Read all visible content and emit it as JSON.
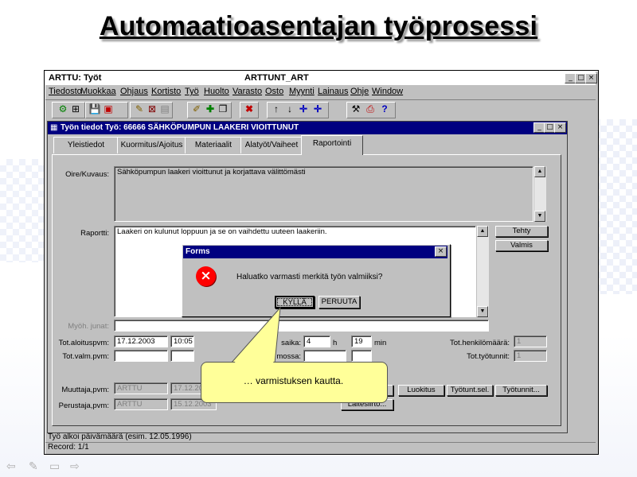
{
  "slide": {
    "title": "Automaatioasentajan työprosessi",
    "callout": "… varmistuksen kautta."
  },
  "app": {
    "title": "ARTTU: Työt",
    "center_title": "ARTTUNT_ART",
    "controls": [
      "_",
      "□",
      "×"
    ],
    "menu": [
      "Tiedosto",
      "Muokkaa",
      "Ohjaus",
      "Kortisto",
      "Työ",
      "Huolto",
      "Varasto",
      "Osto",
      "Myynti",
      "Lainaus",
      "Ohje",
      "Window"
    ]
  },
  "form": {
    "title": "Työn tiedot  Työ: 66666 SÄHKÖPUMPUN LAAKERI VIOITTUNUT",
    "tabs": [
      "Yleistiedot",
      "Kuormitus/Ajoitus",
      "Materiaalit",
      "Alatyöt/Vaiheet",
      "Raportointi"
    ],
    "active_tab": "Raportointi",
    "oire_label": "Oire/Kuvaus:",
    "oire_text": "Sähköpumpun laakeri vioittunut ja korjattava välittömästi",
    "raportti_label": "Raportti:",
    "raportti_text": "Laakeri on kulunut loppuun ja se on vaihdettu uuteen laakeriin.",
    "tehty_button": "Tehty",
    "valmis_button": "Valmis",
    "myoh_label": "Myöh. junat:",
    "aloitus_label": "Tot.aloituspvm:",
    "aloitus_date": "17.12.2003",
    "aloitus_time": "10:05",
    "valm_label": "Tot.valm.pvm:",
    "aika_label": "saika:",
    "aika_h": "4",
    "h_unit": "h",
    "aika_min": "19",
    "min_unit": "min",
    "mossa_label": "mossa:",
    "henkilo_label": "Tot.henkilömäärä:",
    "henkilo_value": "1",
    "tyotunnit_label": "Tot.työtunnit:",
    "tyotunnit_value": "1",
    "muuttaja_label": "Muuttaja,pvm:",
    "muuttaja_user": "ARTTU",
    "muuttaja_date": "17.12.20",
    "perustaja_label": "Perustaja,pvm:",
    "perustaja_user": "ARTTU",
    "perustaja_date": "15.12.2003",
    "luokitus_button": "Luokitus",
    "tyotunt_sel_button": "Työtunt.sel.",
    "tyotunnit_button": "Työtunnit...",
    "laitesiirto_button": "Laitesiirto..."
  },
  "dialog": {
    "title": "Forms",
    "close": "×",
    "message": "Haluatko varmasti merkitä työn valmiiksi?",
    "yes_button": "KYLLÄ",
    "cancel_button": "PERUUTA"
  },
  "status": {
    "line1": "Työ alkoi päivämäärä (esim. 12.05.1996)",
    "line2": "Record: 1/1"
  },
  "nav": [
    "⇦",
    "✎",
    "▭",
    "⇨"
  ]
}
